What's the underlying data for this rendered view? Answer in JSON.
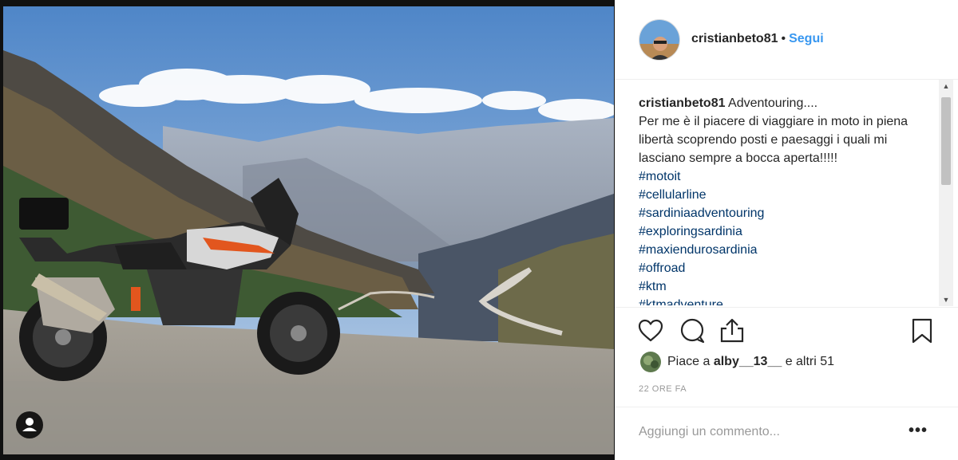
{
  "post": {
    "username": "cristianbeto81",
    "separator": "•",
    "follow_label": "Segui",
    "caption": {
      "username": "cristianbeto81",
      "title": "Adventouring....",
      "body": "Per me è il piacere di viaggiare in moto in piena libertà scoprendo posti e paesaggi i quali mi lasciano sempre a bocca aperta!!!!!",
      "hashtags": [
        "#motoit",
        "#cellularline",
        "#sardiniaadventouring",
        "#exploringsardinia",
        "#maxiendurosardinia",
        "#offroad",
        "#ktm",
        "#ktmadventure"
      ]
    },
    "likes": {
      "prefix": "Piace a",
      "user": "alby__13__",
      "suffix": "e altri 51"
    },
    "time": "22 ORE FA",
    "comment_placeholder": "Aggiungi un commento...",
    "more_label": "•••",
    "icons": {
      "like": "heart-icon",
      "comment": "comment-icon",
      "share": "share-icon",
      "save": "bookmark-icon",
      "tagged_user": "user-tag-icon"
    },
    "colors": {
      "follow": "#3897f0",
      "hashtag": "#003569",
      "text": "#262626",
      "muted": "#999999"
    }
  }
}
